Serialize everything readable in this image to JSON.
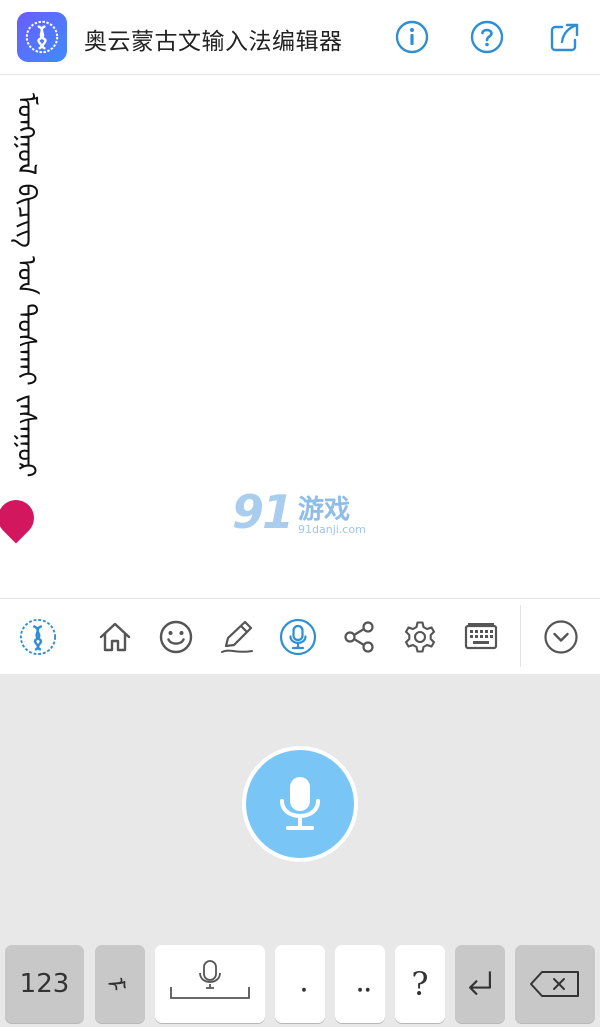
{
  "header": {
    "title": "奥云蒙古文输入法编辑器",
    "info_icon": "info-circle-icon",
    "help_icon": "question-circle-icon",
    "share_icon": "share-export-icon"
  },
  "editor": {
    "mongolian_text": "ᠮᠣᠩᠭᠣᠯ ᠪᠢᠴᠢᠭ ᠤᠨ ᠲᠤᠰᠬᠠᠢ ᠵᠠᠰᠠᠭᠤᠷ",
    "watermark": {
      "logo": "91",
      "name": "游戏",
      "domain": "91danji.com"
    }
  },
  "toolbar": {
    "items": [
      {
        "icon": "app-logo-icon"
      },
      {
        "icon": "home-icon"
      },
      {
        "icon": "emoji-icon"
      },
      {
        "icon": "pencil-icon"
      },
      {
        "icon": "microphone-icon"
      },
      {
        "icon": "share-icon"
      },
      {
        "icon": "gear-icon"
      },
      {
        "icon": "keyboard-icon"
      },
      {
        "icon": "chevron-down-icon"
      }
    ],
    "active_color": "#2f8fd6"
  },
  "keyboard": {
    "keys": {
      "numbers": "123",
      "mongol": "ᠮ",
      "dot": "᠂",
      "double_dot": "᠃",
      "question": "?"
    },
    "mic_color": "#79c6f6"
  }
}
